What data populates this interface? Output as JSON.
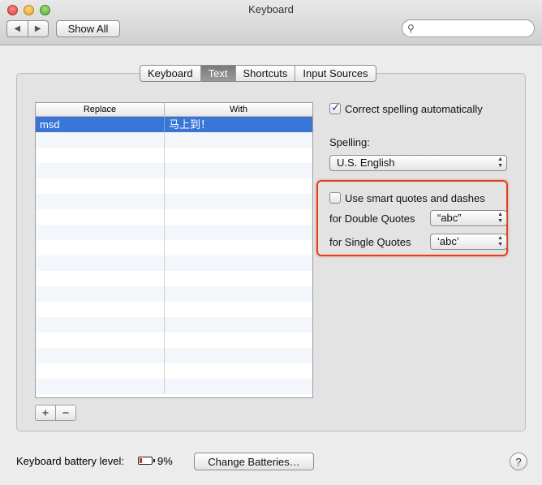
{
  "window": {
    "title": "Keyboard"
  },
  "toolbar": {
    "back_icon": "◀",
    "forward_icon": "▶",
    "show_all_label": "Show All",
    "search_placeholder": "",
    "search_icon": "⚲"
  },
  "tabs": [
    {
      "label": "Keyboard",
      "active": false
    },
    {
      "label": "Text",
      "active": true
    },
    {
      "label": "Shortcuts",
      "active": false
    },
    {
      "label": "Input Sources",
      "active": false
    }
  ],
  "table": {
    "headers": {
      "replace": "Replace",
      "with": "With"
    },
    "rows": [
      {
        "replace": "msd",
        "with": "马上到！",
        "selected": true
      }
    ],
    "add_label": "+",
    "remove_label": "−"
  },
  "options": {
    "correct_spelling_label": "Correct spelling automatically",
    "correct_spelling_checked": true,
    "spelling_label": "Spelling:",
    "spelling_value": "U.S. English",
    "smart_quotes_label": "Use smart quotes and dashes",
    "smart_quotes_checked": false,
    "double_quotes_label": "for Double Quotes",
    "double_quotes_value": "“abc”",
    "single_quotes_label": "for Single Quotes",
    "single_quotes_value": "‘abc’"
  },
  "footer": {
    "battery_label": "Keyboard battery level:",
    "battery_percent": "9%",
    "change_batteries_label": "Change Batteries…",
    "help_label": "?"
  },
  "colors": {
    "selection": "#3875d7",
    "highlight_box": "#e0401c",
    "battery_low": "#e02020"
  }
}
